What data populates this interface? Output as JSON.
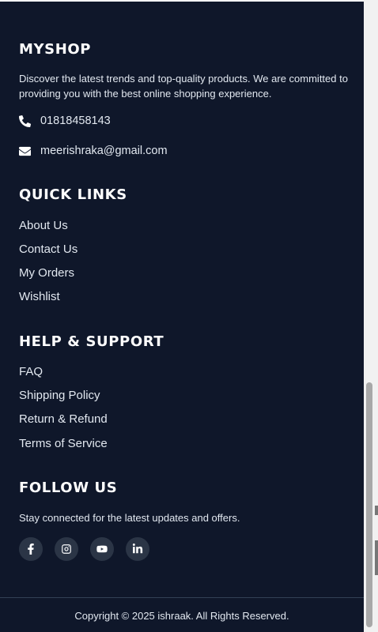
{
  "brand": {
    "title": "MYSHOP",
    "description": "Discover the latest trends and top-quality products. We are committed to providing you with the best online shopping experience."
  },
  "contact": {
    "phone": "01818458143",
    "email": "meerishraka@gmail.com",
    "phone_icon": "phone-icon",
    "email_icon": "envelope-icon"
  },
  "quick_links": {
    "title": "QUICK LINKS",
    "items": [
      "About Us",
      "Contact Us",
      "My Orders",
      "Wishlist"
    ]
  },
  "help": {
    "title": "HELP & SUPPORT",
    "items": [
      "FAQ",
      "Shipping Policy",
      "Return & Refund",
      "Terms of Service"
    ]
  },
  "follow": {
    "title": "FOLLOW US",
    "text": "Stay connected for the latest updates and offers.",
    "icons": [
      "facebook-icon",
      "instagram-icon",
      "youtube-icon",
      "linkedin-icon"
    ]
  },
  "copyright": "Copyright © 2025 ishraak. All Rights Reserved.",
  "colors": {
    "background": "#0f172a",
    "icon_circle": "#2b3546",
    "text": "#e2e8f0"
  }
}
